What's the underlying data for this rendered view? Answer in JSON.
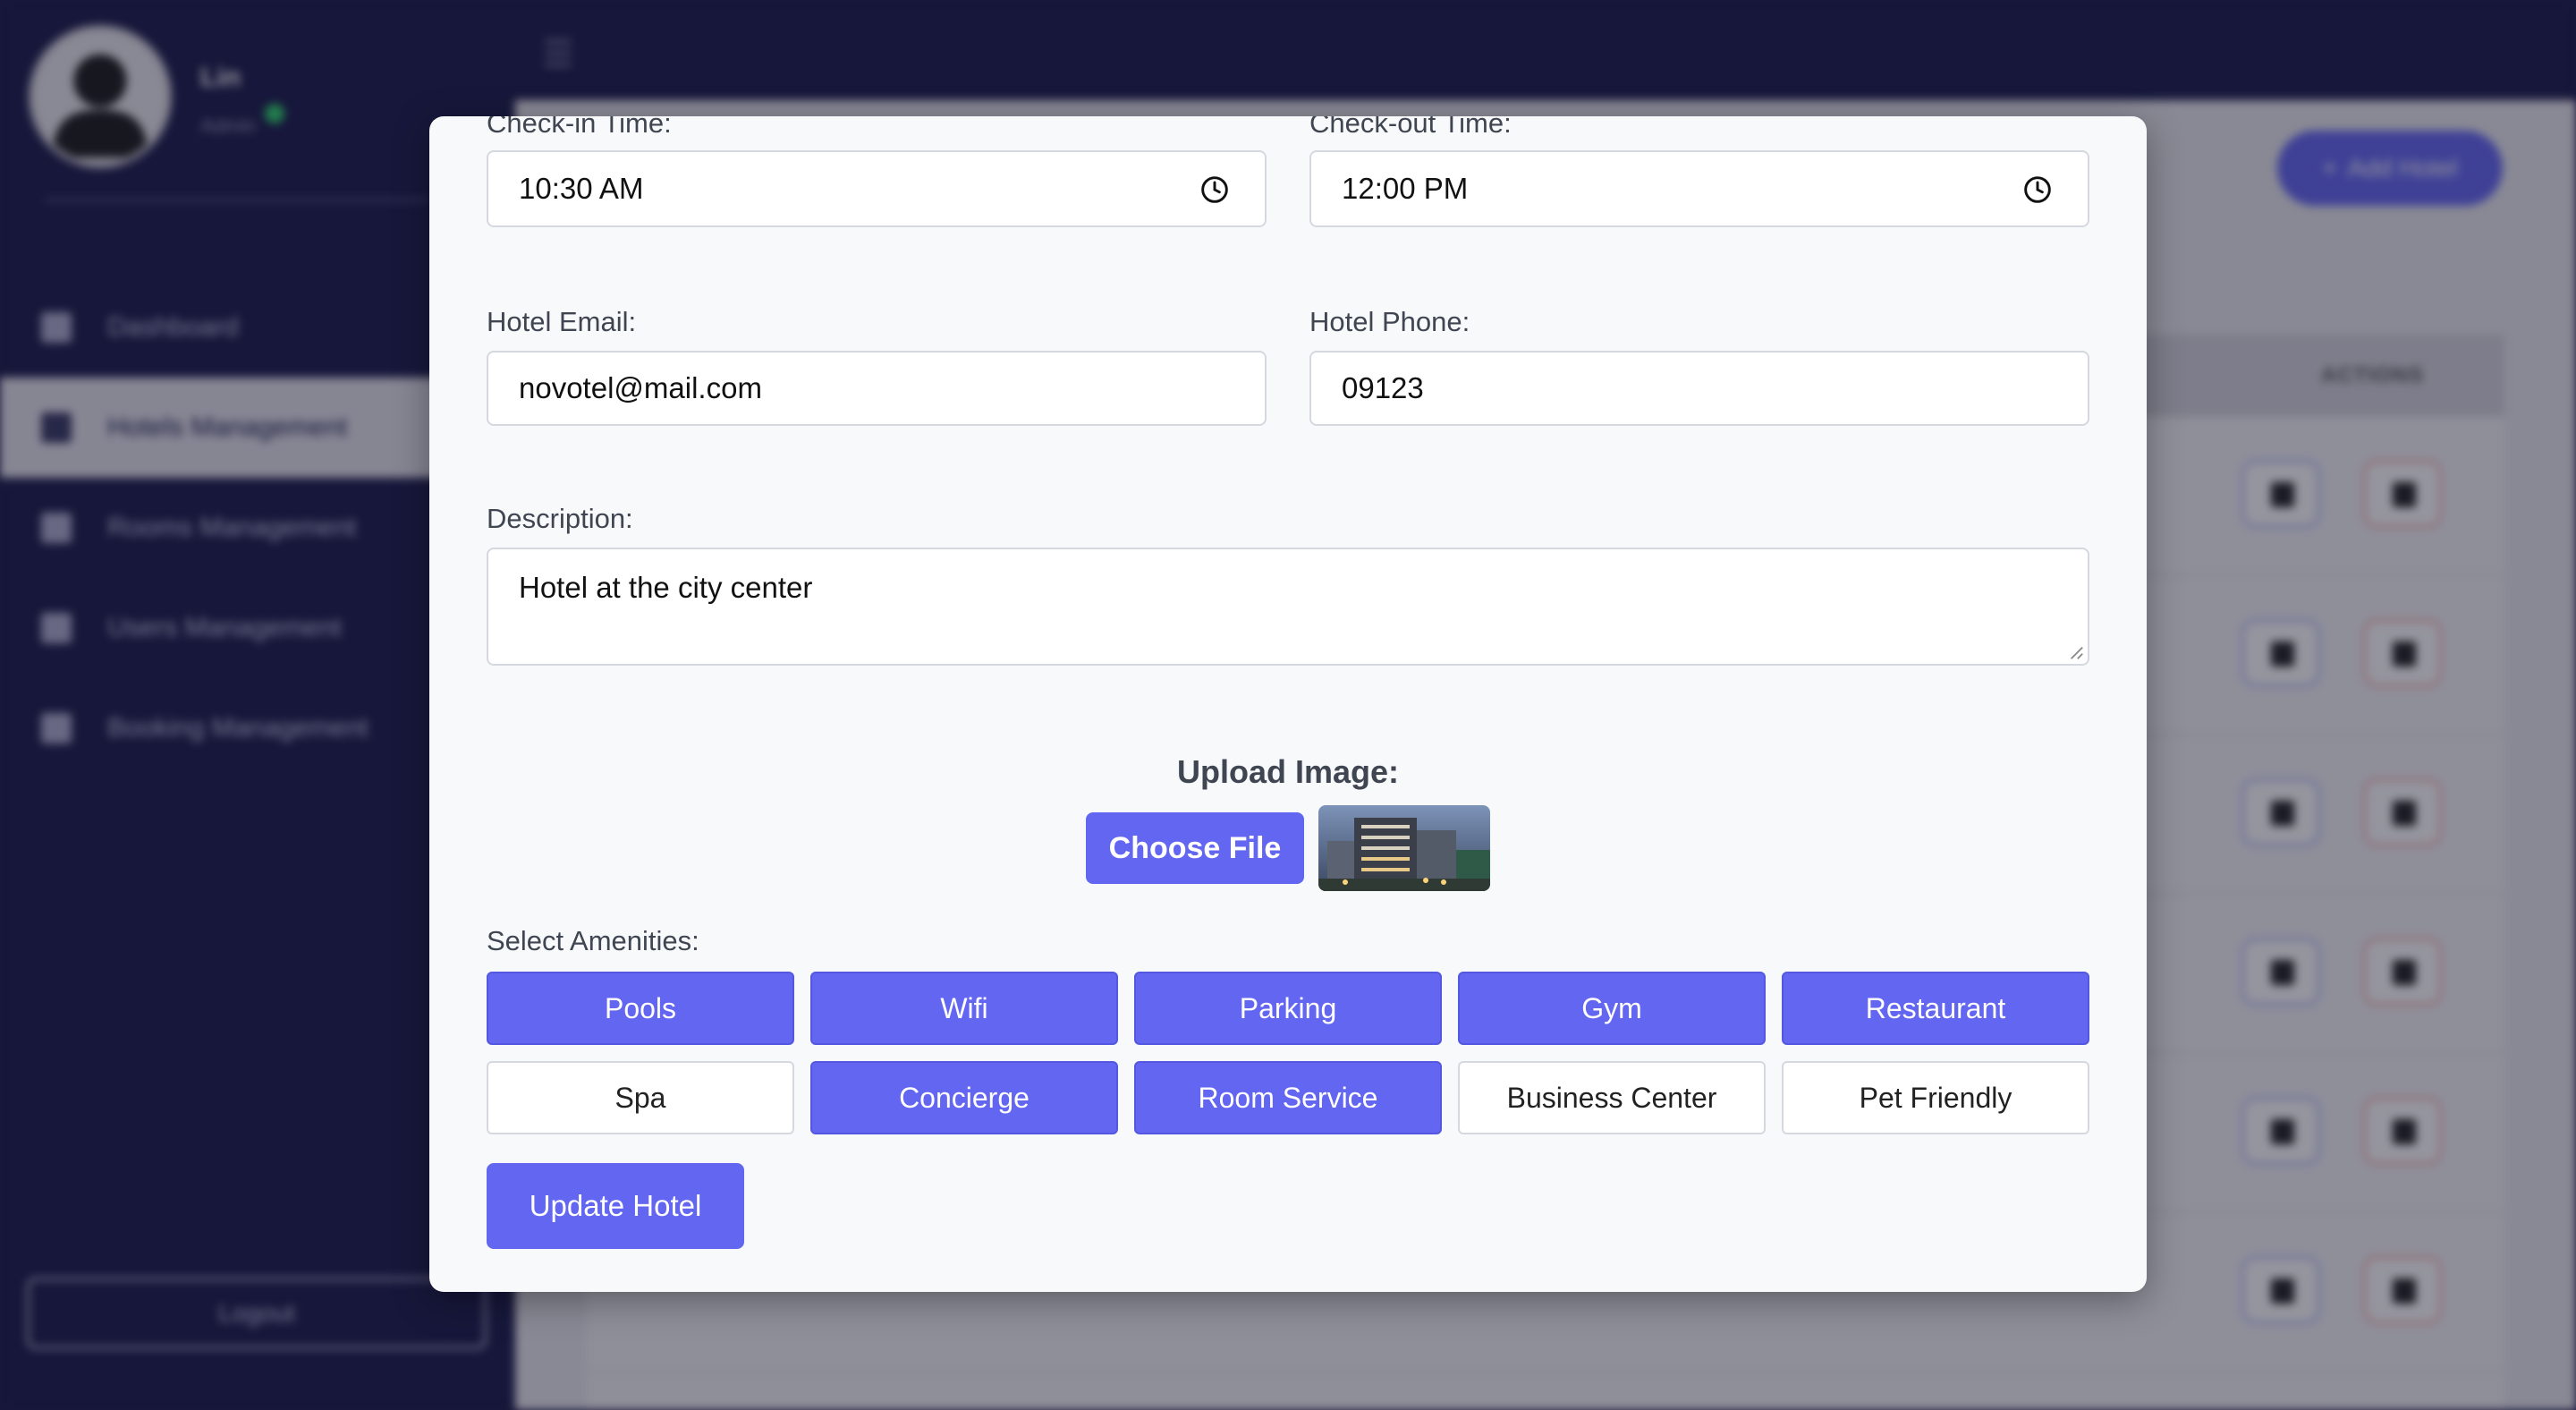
{
  "sidebar": {
    "user_name": "Lin",
    "user_role": "Admin",
    "nav": [
      {
        "label": "Dashboard",
        "icon": "chart-icon",
        "active": false
      },
      {
        "label": "Hotels Management",
        "icon": "building-icon",
        "active": true
      },
      {
        "label": "Rooms Management",
        "icon": "bed-icon",
        "active": false
      },
      {
        "label": "Users Management",
        "icon": "users-icon",
        "active": false
      },
      {
        "label": "Booking Management",
        "icon": "calendar-icon",
        "active": false
      }
    ],
    "logout_label": "Logout"
  },
  "header": {
    "add_hotel_label": "Add Hotel"
  },
  "table": {
    "actions_header": "ACTIONS"
  },
  "modal": {
    "check_in": {
      "label": "Check-in Time:",
      "value": "10:30  AM"
    },
    "check_out": {
      "label": "Check-out Time:",
      "value": "12:00  PM"
    },
    "email": {
      "label": "Hotel Email:",
      "value": "novotel@mail.com"
    },
    "phone": {
      "label": "Hotel Phone:",
      "value": "09123"
    },
    "description": {
      "label": "Description:",
      "value": "Hotel at the city center"
    },
    "upload": {
      "label": "Upload Image:",
      "button": "Choose File"
    },
    "amenities": {
      "label": "Select Amenities:",
      "items": [
        {
          "label": "Pools",
          "selected": true
        },
        {
          "label": "Wifi",
          "selected": true
        },
        {
          "label": "Parking",
          "selected": true
        },
        {
          "label": "Gym",
          "selected": true
        },
        {
          "label": "Restaurant",
          "selected": true
        },
        {
          "label": "Spa",
          "selected": false
        },
        {
          "label": "Concierge",
          "selected": true
        },
        {
          "label": "Room Service",
          "selected": true
        },
        {
          "label": "Business Center",
          "selected": false
        },
        {
          "label": "Pet Friendly",
          "selected": false
        }
      ]
    },
    "submit_label": "Update Hotel"
  },
  "colors": {
    "primary": "#6366f1",
    "sidebar_bg": "#1a1a4b",
    "online": "#2fd36b"
  }
}
